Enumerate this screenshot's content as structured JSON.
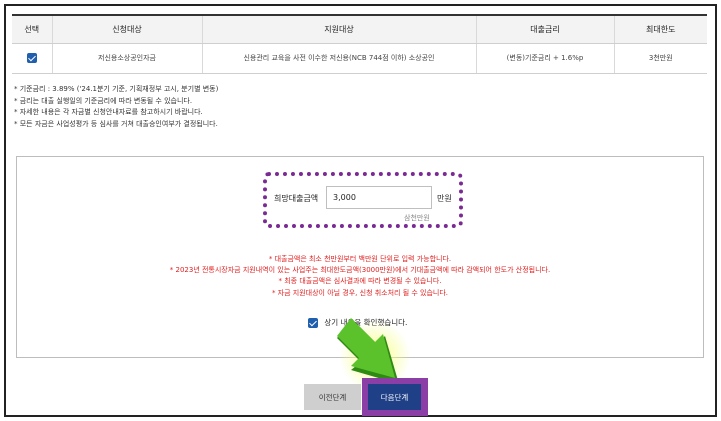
{
  "table": {
    "headers": [
      "선택",
      "신청대상",
      "지원대상",
      "대출금리",
      "최대한도"
    ],
    "row": {
      "target": "저신용소상공인자금",
      "support": "신용관리 교육을 사전 이수한 저신용(NCB 744점 이하) 소상공인",
      "rate": "(변동)기준금리 + 1.6%p",
      "limit": "3천만원"
    }
  },
  "notes": [
    "* 기준금리 : 3.89% ('24.1분기 기준, 기획재정부 고시, 분기별 변동)",
    "* 금리는 대출 실행일의 기준금리에 따라 변동될 수 있습니다.",
    "* 자세한 내용은 각 자금별 신청안내자료를 참고하시기 바랍니다.",
    "* 모든 자금은 사업성평가 등 심사를 거쳐 대출승인여부가 결정됩니다."
  ],
  "amount": {
    "label": "희망대출금액",
    "value": "3,000",
    "unit": "만원",
    "subtext": "삼천만원"
  },
  "warnings": [
    "* 대출금액은 최소 천만원부터 백만원 단위로 입력 가능합니다.",
    "* 2023년 전통시장자금 지원내역이 있는 사업주는 최대한도금액(3000만원)에서 기대출금액에 따라 감액되어 한도가 산정됩니다.",
    "* 최종 대출금액은 심사결과에 따라 변경될 수 있습니다.",
    "* 자금 지원대상이 아닐 경우, 신청 취소처리 될 수 있습니다."
  ],
  "agree_label": "상기 내용을 확인했습니다.",
  "buttons": {
    "prev": "이전단계",
    "next": "다음단계"
  },
  "colors": {
    "accent": "#1f3f86",
    "highlight": "#7a2a93",
    "warning": "#e02020",
    "arrow": "#4caf1f"
  }
}
